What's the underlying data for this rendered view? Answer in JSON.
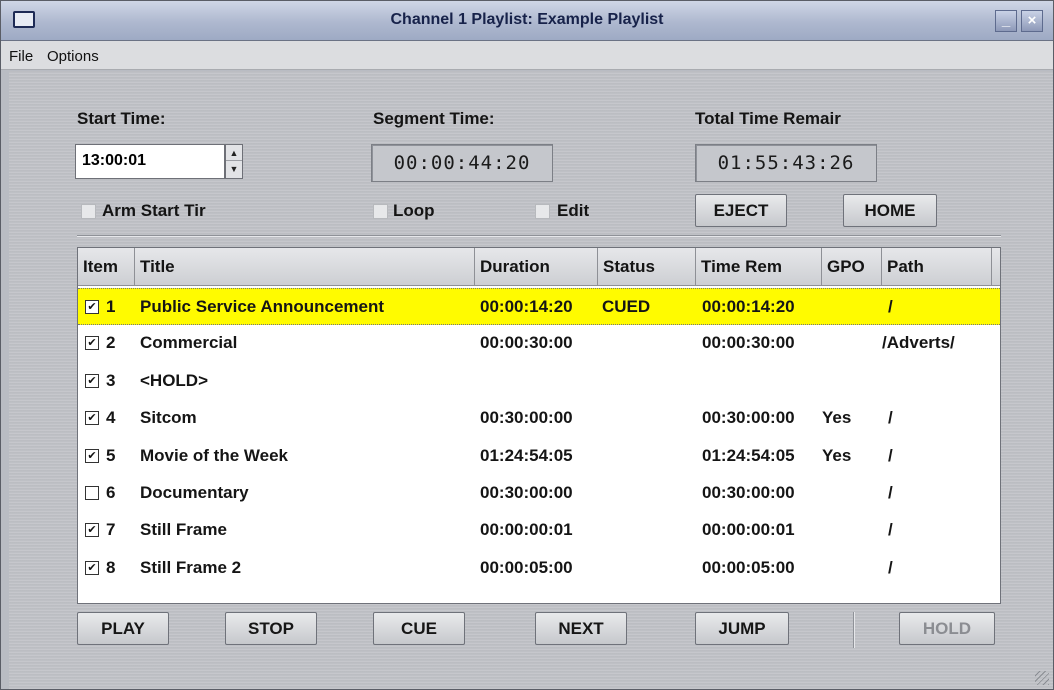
{
  "window": {
    "title": "Channel  1 Playlist:  Example Playlist",
    "minimize_label": "_",
    "close_label": "×"
  },
  "menu": {
    "items": [
      {
        "label": "File"
      },
      {
        "label": "Options"
      }
    ]
  },
  "controls": {
    "start_time_label": "Start Time:",
    "start_time_value": "13:00:01",
    "segment_time_label": "Segment Time:",
    "segment_time_value": "00:00:44:20",
    "total_time_label": "Total Time Remair",
    "total_time_value": "01:55:43:26",
    "arm_start_label": "Arm Start Tir",
    "loop_label": "Loop",
    "edit_label": "Edit",
    "eject_label": "EJECT",
    "home_label": "HOME"
  },
  "table": {
    "columns": [
      "Item",
      "Title",
      "Duration",
      "Status",
      "Time Rem",
      "GPO",
      "Path"
    ],
    "rows": [
      {
        "checked": true,
        "item": "1",
        "title": "Public Service Announcement",
        "duration": "00:00:14:20",
        "status": "CUED",
        "time_rem": "00:00:14:20",
        "gpo": "",
        "path": "/",
        "selected": true
      },
      {
        "checked": true,
        "item": "2",
        "title": "Commercial",
        "duration": "00:00:30:00",
        "status": "",
        "time_rem": "00:00:30:00",
        "gpo": "",
        "path": "/Adverts/",
        "selected": false
      },
      {
        "checked": true,
        "item": "3",
        "title": "<HOLD>",
        "duration": "",
        "status": "",
        "time_rem": "",
        "gpo": "",
        "path": "",
        "selected": false
      },
      {
        "checked": true,
        "item": "4",
        "title": "Sitcom",
        "duration": "00:30:00:00",
        "status": "",
        "time_rem": "00:30:00:00",
        "gpo": "Yes",
        "path": "/",
        "selected": false
      },
      {
        "checked": true,
        "item": "5",
        "title": "Movie of the Week",
        "duration": "01:24:54:05",
        "status": "",
        "time_rem": "01:24:54:05",
        "gpo": "Yes",
        "path": "/",
        "selected": false
      },
      {
        "checked": false,
        "item": "6",
        "title": "Documentary",
        "duration": "00:30:00:00",
        "status": "",
        "time_rem": "00:30:00:00",
        "gpo": "",
        "path": "/",
        "selected": false
      },
      {
        "checked": true,
        "item": "7",
        "title": "Still Frame",
        "duration": "00:00:00:01",
        "status": "",
        "time_rem": "00:00:00:01",
        "gpo": "",
        "path": "/",
        "selected": false
      },
      {
        "checked": true,
        "item": "8",
        "title": "Still Frame 2",
        "duration": "00:00:05:00",
        "status": "",
        "time_rem": "00:00:05:00",
        "gpo": "",
        "path": "/",
        "selected": false
      }
    ]
  },
  "buttons": {
    "play": "PLAY",
    "stop": "STOP",
    "cue": "CUE",
    "next": "NEXT",
    "jump": "JUMP",
    "hold": "HOLD"
  },
  "colors": {
    "selected_row": "#fffb00",
    "title_text": "#17224a"
  }
}
